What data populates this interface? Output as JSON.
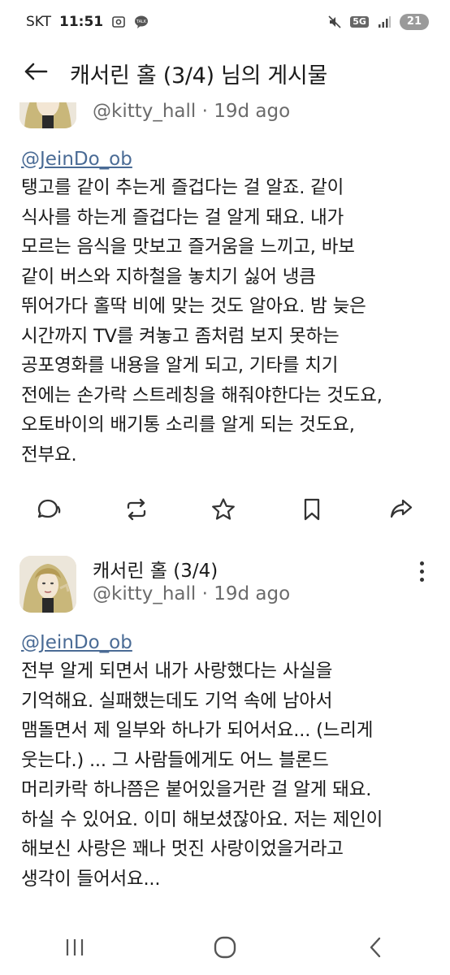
{
  "status_bar": {
    "carrier": "SKT",
    "time": "11:51",
    "network": "5G",
    "battery": "21",
    "icons": [
      "screenshot-icon",
      "talk-icon",
      "mute-icon",
      "5g-icon",
      "signal-icon"
    ]
  },
  "header": {
    "title": "캐서린 홀 (3/4) 님의 게시물",
    "back_icon": "arrow-left-icon"
  },
  "posts": [
    {
      "handle_line": "@kitty_hall · 19d ago",
      "mention": "@JeinDo_ob",
      "body": "탱고를 같이 추는게 즐겁다는 걸 알죠. 같이\n식사를 하는게 즐겁다는 걸 알게 돼요. 내가\n모르는 음식을 맛보고 즐거움을 느끼고, 바보\n같이 버스와 지하철을 놓치기 싫어 냉큼\n뛰어가다 홀딱 비에 맞는 것도 알아요. 밤 늦은\n시간까지 TV를 켜놓고 좀처럼 보지 못하는\n공포영화를 내용을 알게 되고, 기타를 치기\n전에는 손가락 스트레칭을 해줘야한다는 것도요,\n오토바이의 배기통 소리를 알게 되는 것도요,\n전부요.",
      "actions": [
        "reply-icon",
        "repost-icon",
        "star-icon",
        "bookmark-icon",
        "share-icon"
      ]
    },
    {
      "display_name": "캐서린 홀 (3/4)",
      "handle_line": "@kitty_hall · 19d ago",
      "mention": "@JeinDo_ob",
      "body": "전부 알게 되면서 내가 사랑했다는 사실을\n기억해요. 실패했는데도 기억 속에 남아서\n맴돌면서 제 일부와 하나가 되어서요... (느리게\n웃는다.) ... 그 사람들에게도 어느 블론드\n머리카락 하나쯤은 붙어있을거란 걸 알게 돼요.\n하실 수 있어요. 이미 해보셨잖아요. 저는 제인이\n해보신 사랑은 꽤나 멋진 사랑이었을거라고\n생각이 들어서요..."
    }
  ],
  "nav_bar": {
    "buttons": [
      "recent-apps-icon",
      "home-icon",
      "back-icon"
    ]
  }
}
